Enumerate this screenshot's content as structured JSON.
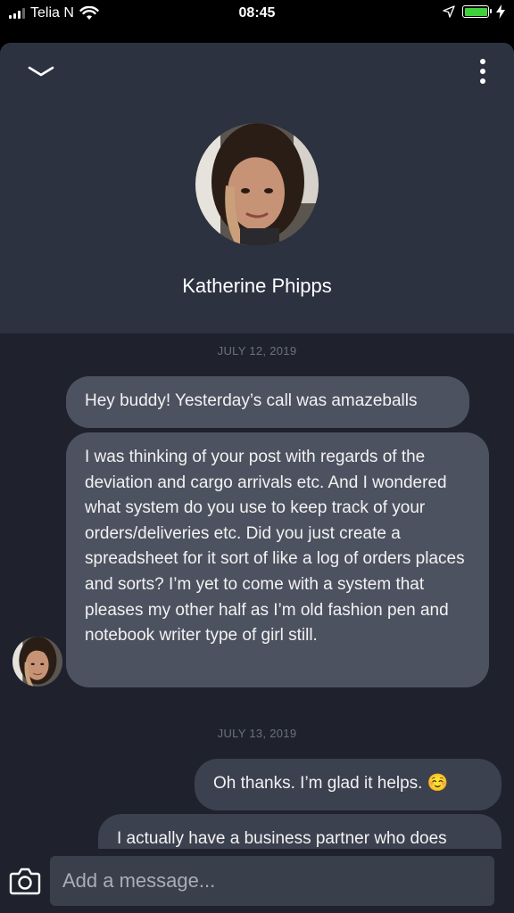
{
  "status_bar": {
    "carrier": "Telia N",
    "time": "08:45"
  },
  "contact": {
    "name": "Katherine Phipps"
  },
  "conversation": [
    {
      "date": "JULY 12, 2019",
      "messages": [
        {
          "direction": "incoming",
          "text": "Hey buddy! Yesterday’s call was amazeballs"
        },
        {
          "direction": "incoming",
          "text": "I was thinking of your post with regards of the deviation and cargo arrivals etc. And I wondered what system do you use to keep track of your orders/deliveries etc. Did you just create a spreadsheet for it sort of like a log of orders places and sorts? I’m yet to come with a system that pleases my other half as I’m old fashion pen and notebook writer type of girl still."
        }
      ]
    },
    {
      "date": "JULY 13, 2019",
      "messages": [
        {
          "direction": "outgoing",
          "text": "Oh thanks.  I’m glad it helps. ☺️"
        },
        {
          "direction": "outgoing",
          "text": "I actually have a business partner who does"
        }
      ]
    }
  ],
  "composer": {
    "placeholder": "Add a message..."
  },
  "colors": {
    "header_bg": "#2c3240",
    "chat_bg": "#1f222d",
    "incoming_bubble": "#4d5260",
    "outgoing_bubble": "#3c4150",
    "battery": "#3fd13c"
  },
  "icons": [
    "signal-bars-icon",
    "wifi-icon",
    "location-arrow-icon",
    "battery-icon",
    "charging-bolt-icon",
    "chevron-down-icon",
    "more-vertical-icon",
    "camera-icon"
  ]
}
